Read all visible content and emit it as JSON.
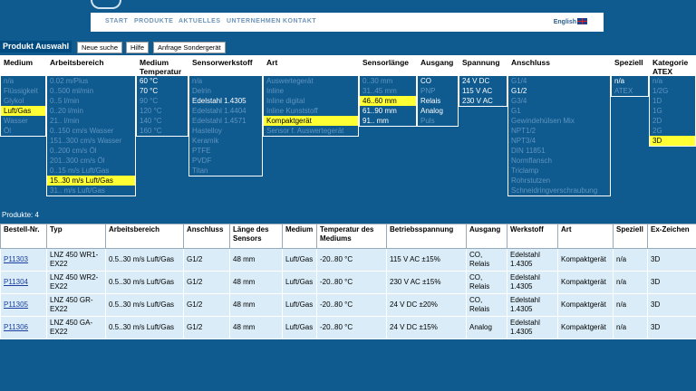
{
  "nav": {
    "items": [
      "START",
      "PRODUKTE",
      "AKTUELLES",
      "UNTERNEHMEN",
      "KONTAKT"
    ],
    "language": "English"
  },
  "toolbar": {
    "title": "Produkt Auswahl",
    "tabs": [
      "Neue suche",
      "Hilfe",
      "Anfrage Sondergerät"
    ]
  },
  "filters": [
    {
      "header": "Medium",
      "options": [
        {
          "label": "n/a",
          "state": "disabled"
        },
        {
          "label": "Flüssigkeit",
          "state": "disabled"
        },
        {
          "label": "Glykol",
          "state": "disabled"
        },
        {
          "label": "Luft/Gas",
          "state": "selected"
        },
        {
          "label": "Wasser",
          "state": "disabled"
        },
        {
          "label": "Öl",
          "state": "disabled"
        }
      ]
    },
    {
      "header": "Arbeitsbereich",
      "options": [
        {
          "label": "0.02 m/Plus",
          "state": "disabled"
        },
        {
          "label": "0..500 ml/min",
          "state": "disabled"
        },
        {
          "label": "0..5 l/min",
          "state": "disabled"
        },
        {
          "label": "0..20 l/min",
          "state": "disabled"
        },
        {
          "label": "21.. l/min",
          "state": "disabled"
        },
        {
          "label": "0..150 cm/s Wasser",
          "state": "disabled"
        },
        {
          "label": "151..300 cm/s Wasser",
          "state": "disabled"
        },
        {
          "label": "0..200 cm/s Öl",
          "state": "disabled"
        },
        {
          "label": "201..300 cm/s Öl",
          "state": "disabled"
        },
        {
          "label": "0..15 m/s Luft/Gas",
          "state": "disabled"
        },
        {
          "label": "15..30 m/s Luft/Gas",
          "state": "selected"
        },
        {
          "label": "31.. m/s Luft/Gas",
          "state": "disabled"
        }
      ]
    },
    {
      "header": "Medium Temperatur",
      "options": [
        {
          "label": "60 °C",
          "state": "active"
        },
        {
          "label": "70 °C",
          "state": "active"
        },
        {
          "label": "90 °C",
          "state": "disabled"
        },
        {
          "label": "120 °C",
          "state": "disabled"
        },
        {
          "label": "140 °C",
          "state": "disabled"
        },
        {
          "label": "160 °C",
          "state": "disabled"
        }
      ]
    },
    {
      "header": "Sensorwerkstoff",
      "options": [
        {
          "label": "n/a",
          "state": "disabled"
        },
        {
          "label": "Delrin",
          "state": "disabled"
        },
        {
          "label": "Edelstahl 1.4305",
          "state": "active"
        },
        {
          "label": "Edelstahl 1.4404",
          "state": "disabled"
        },
        {
          "label": "Edelstahl 1.4571",
          "state": "disabled"
        },
        {
          "label": "Hastelloy",
          "state": "disabled"
        },
        {
          "label": "Keramik",
          "state": "disabled"
        },
        {
          "label": "PTFE",
          "state": "disabled"
        },
        {
          "label": "PVDF",
          "state": "disabled"
        },
        {
          "label": "Titan",
          "state": "disabled"
        }
      ]
    },
    {
      "header": "Art",
      "options": [
        {
          "label": "Auswertegerät",
          "state": "disabled"
        },
        {
          "label": "Inline",
          "state": "disabled"
        },
        {
          "label": "Inline digital",
          "state": "disabled"
        },
        {
          "label": "Inline Kunststoff",
          "state": "disabled"
        },
        {
          "label": "Kompaktgerät",
          "state": "selected"
        },
        {
          "label": "Sensor f. Auswertegerät",
          "state": "disabled"
        }
      ]
    },
    {
      "header": "Sensorlänge",
      "options": [
        {
          "label": "0..30 mm",
          "state": "disabled"
        },
        {
          "label": "31..45 mm",
          "state": "disabled"
        },
        {
          "label": "46..60 mm",
          "state": "selected"
        },
        {
          "label": "61..90 mm",
          "state": "active"
        },
        {
          "label": "91.. mm",
          "state": "active"
        }
      ]
    },
    {
      "header": "Ausgang",
      "options": [
        {
          "label": "CO",
          "state": "active"
        },
        {
          "label": "PNP",
          "state": "disabled"
        },
        {
          "label": "Relais",
          "state": "active"
        },
        {
          "label": "Analog",
          "state": "active"
        },
        {
          "label": "Puls",
          "state": "disabled"
        }
      ]
    },
    {
      "header": "Spannung",
      "options": [
        {
          "label": "24 V DC",
          "state": "active"
        },
        {
          "label": "115 V AC",
          "state": "active"
        },
        {
          "label": "230 V AC",
          "state": "active"
        }
      ]
    },
    {
      "header": "Anschluss",
      "options": [
        {
          "label": "G1/4",
          "state": "disabled"
        },
        {
          "label": "G1/2",
          "state": "active"
        },
        {
          "label": "G3/4",
          "state": "disabled"
        },
        {
          "label": "G1",
          "state": "disabled"
        },
        {
          "label": "Gewindehülsen Mix",
          "state": "disabled"
        },
        {
          "label": "NPT1/2",
          "state": "disabled"
        },
        {
          "label": "NPT3/4",
          "state": "disabled"
        },
        {
          "label": "DIN 11851",
          "state": "disabled"
        },
        {
          "label": "Normflansch",
          "state": "disabled"
        },
        {
          "label": "Triclamp",
          "state": "disabled"
        },
        {
          "label": "Rohrstutzen",
          "state": "disabled"
        },
        {
          "label": "Schneidringverschraubung",
          "state": "disabled"
        }
      ]
    },
    {
      "header": "Speziell",
      "options": [
        {
          "label": "n/a",
          "state": "active"
        },
        {
          "label": "ATEX",
          "state": "disabled"
        }
      ]
    },
    {
      "header": "Kategorie ATEX",
      "options": [
        {
          "label": "n/a",
          "state": "disabled"
        },
        {
          "label": "1/2G",
          "state": "disabled"
        },
        {
          "label": "1D",
          "state": "disabled"
        },
        {
          "label": "1G",
          "state": "disabled"
        },
        {
          "label": "2D",
          "state": "disabled"
        },
        {
          "label": "2G",
          "state": "disabled"
        },
        {
          "label": "3D",
          "state": "selected"
        }
      ]
    }
  ],
  "results": {
    "count_label": "Produkte: 4",
    "columns": [
      "Bestell-Nr.",
      "Typ",
      "Arbeitsbereich",
      "Anschluss",
      "Länge des Sensors",
      "Medium",
      "Temperatur des Mediums",
      "Betriebsspannung",
      "Ausgang",
      "Werkstoff",
      "Art",
      "Speziell",
      "Ex-Zeichen"
    ],
    "rows": [
      [
        "P11303",
        "LNZ 450 WR1-EX22",
        "0.5..30 m/s Luft/Gas",
        "G1/2",
        "48 mm",
        "Luft/Gas",
        "-20..80 °C",
        "115 V AC ±15%",
        "CO, Relais",
        "Edelstahl 1.4305",
        "Kompaktgerät",
        "n/a",
        "3D"
      ],
      [
        "P11304",
        "LNZ 450 WR2-EX22",
        "0.5..30 m/s Luft/Gas",
        "G1/2",
        "48 mm",
        "Luft/Gas",
        "-20..80 °C",
        "230 V AC ±15%",
        "CO, Relais",
        "Edelstahl 1.4305",
        "Kompaktgerät",
        "n/a",
        "3D"
      ],
      [
        "P11305",
        "LNZ 450 GR-EX22",
        "0.5..30 m/s Luft/Gas",
        "G1/2",
        "48 mm",
        "Luft/Gas",
        "-20..80 °C",
        "24 V DC ±20%",
        "CO, Relais",
        "Edelstahl 1.4305",
        "Kompaktgerät",
        "n/a",
        "3D"
      ],
      [
        "P11306",
        "LNZ 450 GA-EX22",
        "0.5..30 m/s Luft/Gas",
        "G1/2",
        "48 mm",
        "Luft/Gas",
        "-20..80 °C",
        "24 V DC ±15%",
        "Analog",
        "Edelstahl 1.4305",
        "Kompaktgerät",
        "n/a",
        "3D"
      ]
    ]
  }
}
